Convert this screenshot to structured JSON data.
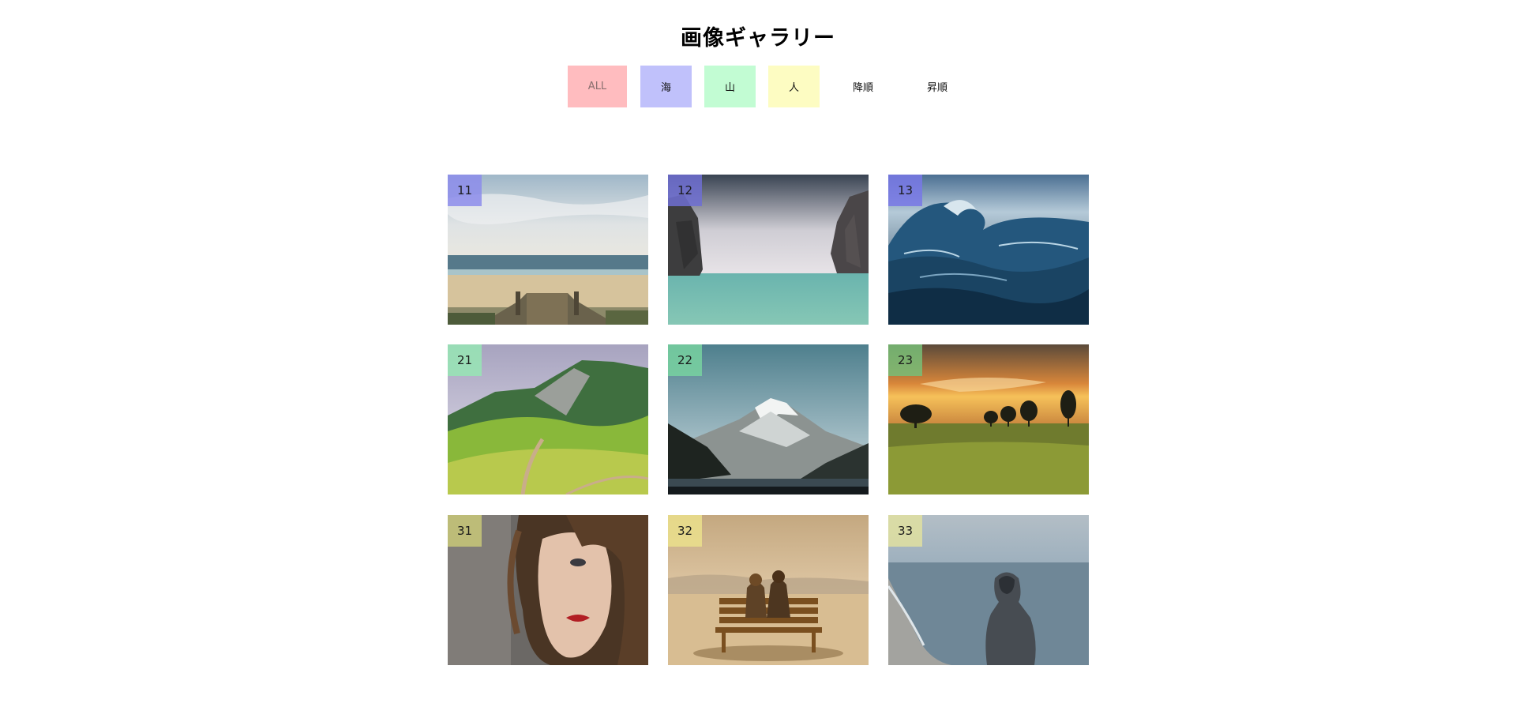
{
  "page": {
    "title": "画像ギャラリー"
  },
  "filters": {
    "all": {
      "label": "ALL",
      "color": "#ffbcbf"
    },
    "sea": {
      "label": "海",
      "color": "#c0c1fb"
    },
    "mountain": {
      "label": "山",
      "color": "#c2fcd3"
    },
    "people": {
      "label": "人",
      "color": "#fdfcc2"
    },
    "desc": {
      "label": "降順"
    },
    "asc": {
      "label": "昇順"
    }
  },
  "gallery": {
    "items": [
      {
        "num": "11",
        "category": "sea",
        "badge_color": "rgba(140,140,235,0.85)",
        "scene": "beach-boardwalk"
      },
      {
        "num": "12",
        "category": "sea",
        "badge_color": "rgba(110,110,210,0.85)",
        "scene": "sea-cliffs"
      },
      {
        "num": "13",
        "category": "sea",
        "badge_color": "rgba(120,120,230,0.85)",
        "scene": "ocean-wave"
      },
      {
        "num": "21",
        "category": "mountain",
        "badge_color": "rgba(150,230,180,0.85)",
        "scene": "green-hills"
      },
      {
        "num": "22",
        "category": "mountain",
        "badge_color": "rgba(120,210,160,0.85)",
        "scene": "snowy-peak"
      },
      {
        "num": "23",
        "category": "mountain",
        "badge_color": "rgba(120,190,120,0.85)",
        "scene": "sunset-field"
      },
      {
        "num": "31",
        "category": "people",
        "badge_color": "rgba(200,200,120,0.85)",
        "scene": "woman-portrait"
      },
      {
        "num": "32",
        "category": "people",
        "badge_color": "rgba(235,225,140,0.85)",
        "scene": "couple-bench"
      },
      {
        "num": "33",
        "category": "people",
        "badge_color": "rgba(225,225,160,0.85)",
        "scene": "hooded-person-shore"
      }
    ]
  }
}
